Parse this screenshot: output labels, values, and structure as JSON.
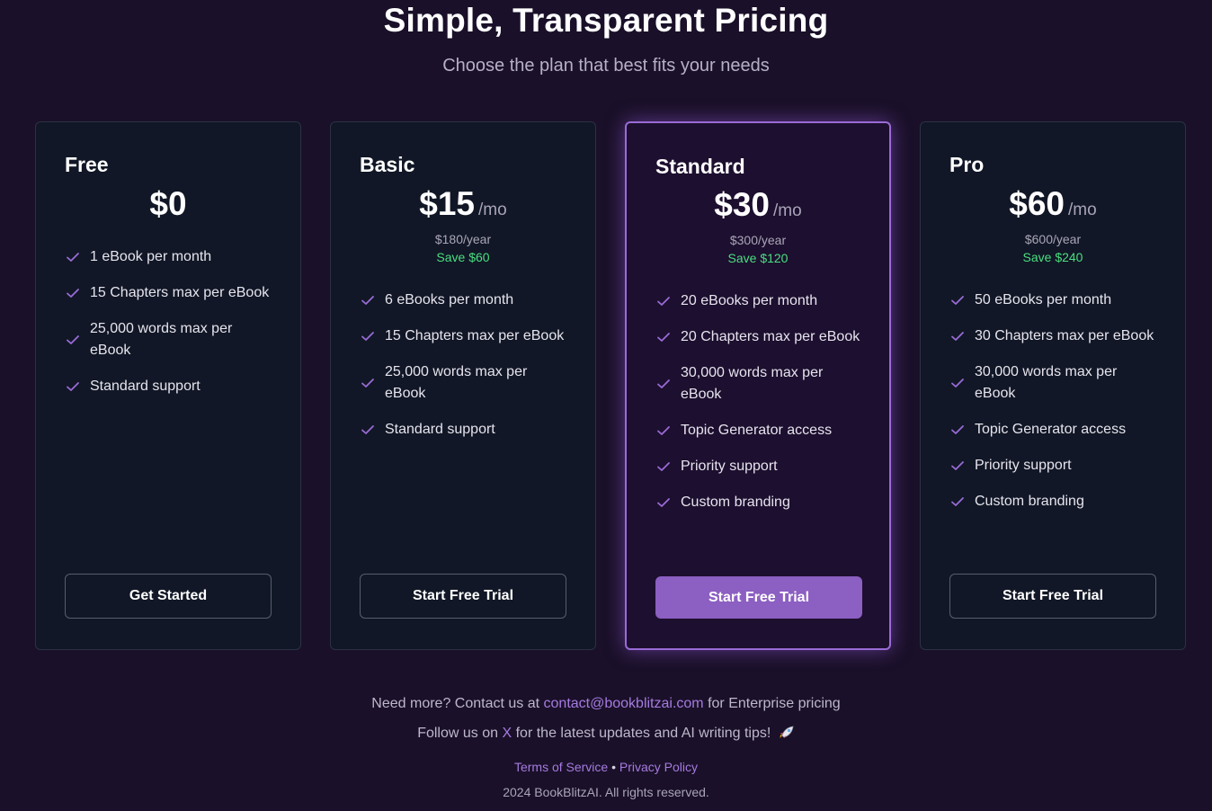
{
  "header": {
    "title": "Simple, Transparent Pricing",
    "subtitle": "Choose the plan that best fits your needs"
  },
  "colors": {
    "background": "#1a1029",
    "card": "#111726",
    "featured_card": "#1d0f2f",
    "accent": "#8c5fc2",
    "check": "#9a6bd6",
    "save": "#4ade80"
  },
  "plans": [
    {
      "name": "Free",
      "price": "$0",
      "period": "",
      "yearly": "",
      "save": "",
      "features": [
        "1 eBook per month",
        "15 Chapters max per eBook",
        "25,000 words max per eBook",
        "Standard support"
      ],
      "cta": "Get Started"
    },
    {
      "name": "Basic",
      "price": "$15",
      "period": "/mo",
      "yearly": "$180/year",
      "save": "Save $60",
      "features": [
        "6 eBooks per month",
        "15 Chapters max per eBook",
        "25,000 words max per eBook",
        "Standard support"
      ],
      "cta": "Start Free Trial"
    },
    {
      "name": "Standard",
      "price": "$30",
      "period": "/mo",
      "yearly": "$300/year",
      "save": "Save $120",
      "features": [
        "20 eBooks per month",
        "20 Chapters max per eBook",
        "30,000 words max per eBook",
        "Topic Generator access",
        "Priority support",
        "Custom branding"
      ],
      "cta": "Start Free Trial"
    },
    {
      "name": "Pro",
      "price": "$60",
      "period": "/mo",
      "yearly": "$600/year",
      "save": "Save $240",
      "features": [
        "50 eBooks per month",
        "30 Chapters max per eBook",
        "30,000 words max per eBook",
        "Topic Generator access",
        "Priority support",
        "Custom branding"
      ],
      "cta": "Start Free Trial"
    }
  ],
  "footer": {
    "contact_prefix": "Need more? Contact us at",
    "contact_email": "contact@bookblitzai.com",
    "contact_suffix": "for Enterprise pricing",
    "follow_prefix": "Follow us on",
    "follow_link": "X",
    "follow_suffix": "for the latest updates and AI writing tips!",
    "rocket_icon": "rocket-icon",
    "terms": "Terms of Service",
    "separator": "•",
    "privacy": "Privacy Policy",
    "copyright": "2024 BookBlitzAI. All rights reserved."
  }
}
